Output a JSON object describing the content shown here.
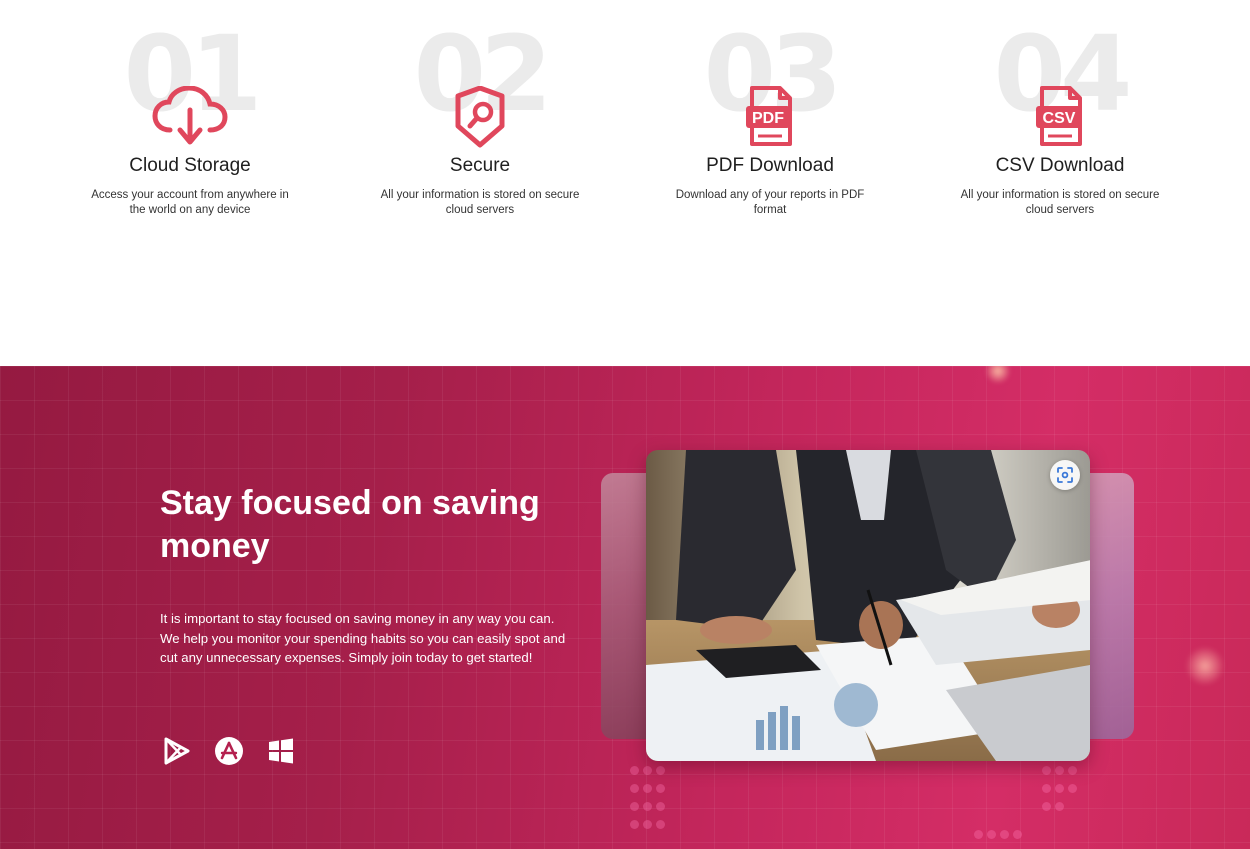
{
  "features": [
    {
      "number": "01",
      "title": "Cloud Storage",
      "description": "Access your account from anywhere in the world on any device",
      "icon": "cloud-download-icon"
    },
    {
      "number": "02",
      "title": "Secure",
      "description": "All your information is stored on secure cloud servers",
      "icon": "shield-search-icon"
    },
    {
      "number": "03",
      "title": "PDF Download",
      "description": "Download any of your reports in PDF format",
      "icon": "pdf-file-icon"
    },
    {
      "number": "04",
      "title": "CSV Download",
      "description": "All your information is stored on secure cloud servers",
      "icon": "csv-file-icon"
    }
  ],
  "hero": {
    "heading": "Stay focused on saving money",
    "body": "It is important to stay focused on saving money in any way you can. We help you monitor your spending habits so you can easily spot and cut any unnecessary expenses. Simply join today to get started!",
    "stores": [
      "google-play-icon",
      "app-store-icon",
      "windows-icon"
    ],
    "image_icon": "lens-icon"
  },
  "colors": {
    "accent": "#e0475c",
    "number_gray": "#ebebeb",
    "hero_start": "#951a41",
    "hero_end": "#d42d66"
  }
}
